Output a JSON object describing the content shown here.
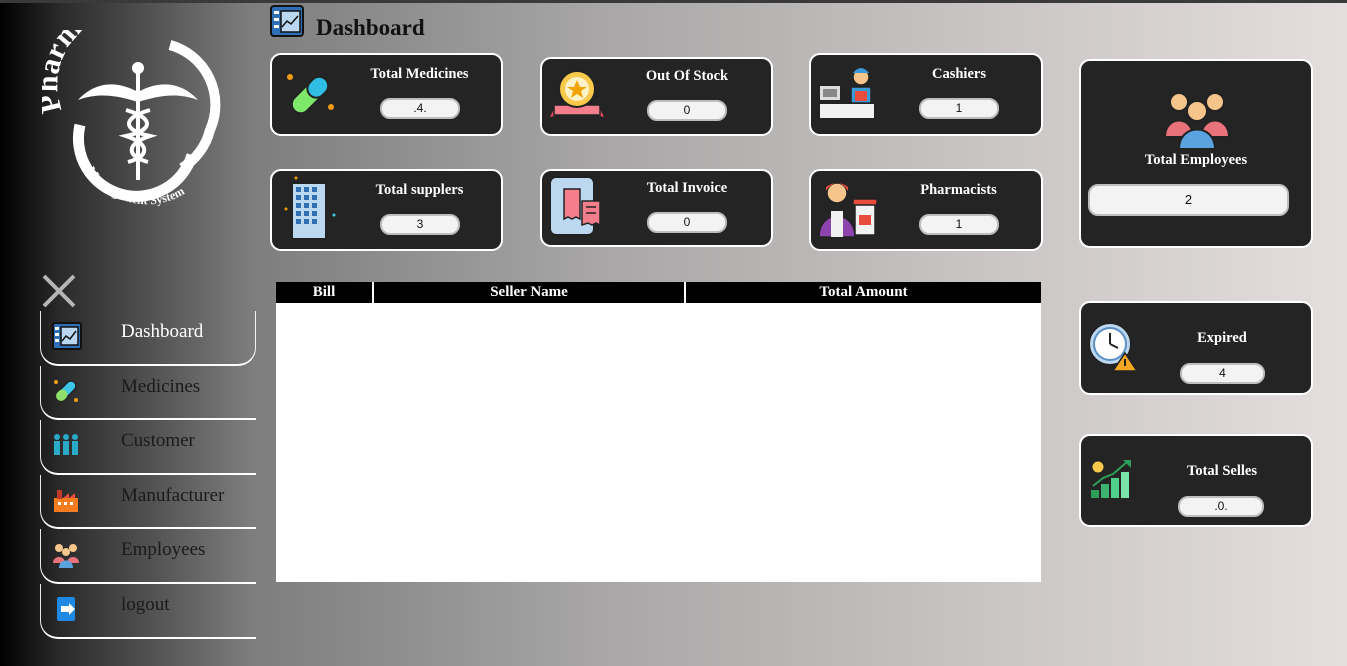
{
  "header": {
    "title": "Dashboard"
  },
  "logo": {
    "line1": "Pharmacy",
    "line2": "Maneagement System"
  },
  "sidebar": {
    "items": [
      {
        "label": "Dashboard"
      },
      {
        "label": "Medicines"
      },
      {
        "label": "Customer"
      },
      {
        "label": "Manufacturer"
      },
      {
        "label": "Employees"
      },
      {
        "label": "logout"
      }
    ]
  },
  "cards": {
    "total_medicines": {
      "title": "Total Medicines",
      "value": ".4."
    },
    "out_of_stock": {
      "title": "Out Of Stock",
      "value": "0"
    },
    "cashiers": {
      "title": "Cashiers",
      "value": "1"
    },
    "total_suppliers": {
      "title": "Total supplers",
      "value": "3"
    },
    "total_invoice": {
      "title": "Total Invoice",
      "value": "0"
    },
    "pharmacists": {
      "title": "Pharmacists",
      "value": "1"
    },
    "total_employees": {
      "title": "Total Employees",
      "value": "2"
    },
    "expired": {
      "title": "Expired",
      "value": "4"
    },
    "total_selles": {
      "title": "Total Selles",
      "value": ".0."
    }
  },
  "table": {
    "columns": [
      "Bill",
      "Seller Name",
      "Total Amount"
    ],
    "rows": []
  }
}
